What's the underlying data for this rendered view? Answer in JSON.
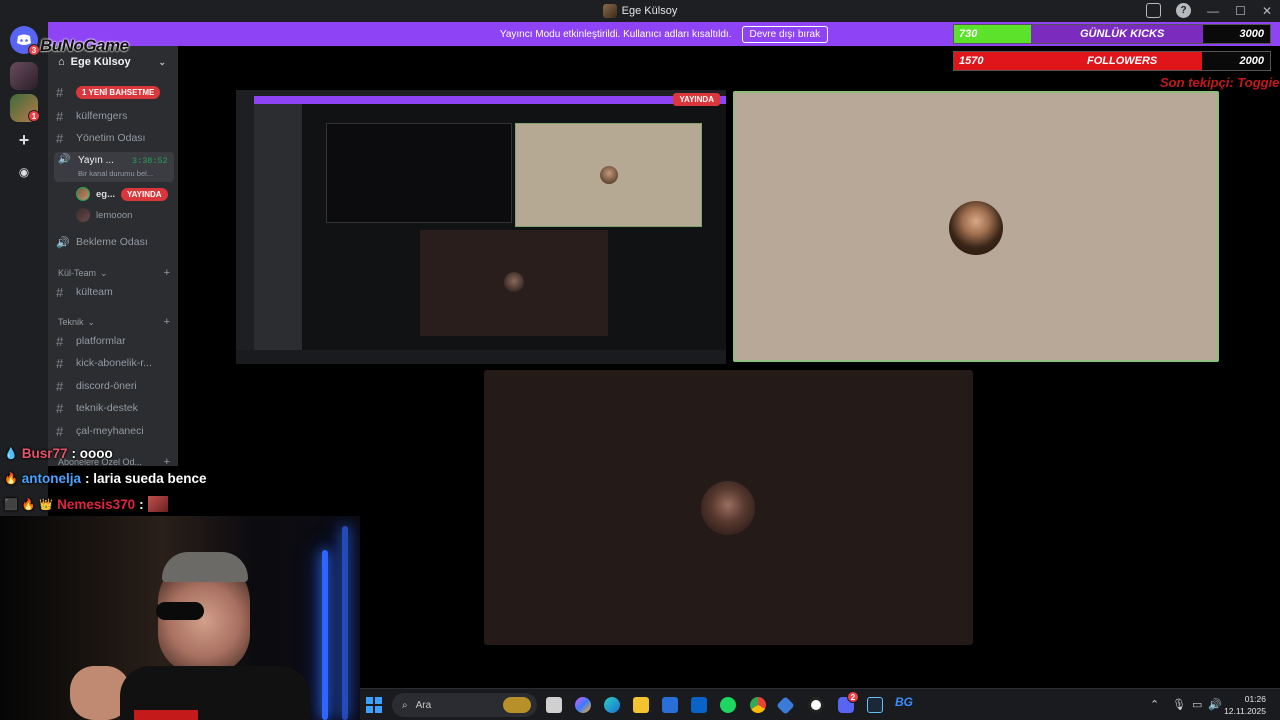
{
  "window": {
    "title": "Ege Külsoy",
    "minimize_glyph": "—",
    "maximize_glyph": "☐",
    "close_glyph": "✕",
    "help_glyph": "?"
  },
  "streamer_banner": {
    "message": "Yayıncı Modu etkinleştirildi. Kullanıcı adları kısaltıldı.",
    "disable_button": "Devre dışı bırak",
    "color": "#8e44f4"
  },
  "overlay": {
    "brand": "BuNoGame",
    "daily_kicks": {
      "current": "730",
      "label": "GÜNLÜK KICKS",
      "goal": "3000",
      "progress_fraction": 0.243,
      "color": "#5ce22a"
    },
    "followers": {
      "current": "1570",
      "label": "FOLLOWERS",
      "goal": "2000",
      "progress_fraction": 0.785,
      "color": "#e0141b"
    },
    "last_tip": "Son tekipçi: Toggiet"
  },
  "rail": {
    "home_icon": "discord-logo-icon",
    "home_badge": "3",
    "server2_badge": "1",
    "add_glyph": "+",
    "explore_glyph": "◉"
  },
  "sidebar": {
    "server_name": "Ege Külsoy",
    "server_chevron": "⌄",
    "new_posts": "1 YENİ BAHSETME",
    "channels": {
      "kulfemgers": "külfemgers",
      "yonetim": "Yönetim Odası",
      "yayin": "Yayın ...",
      "yayin_timer": "3:38:52",
      "yayin_status": "Bir kanal durumu bel...",
      "bekleme": "Bekleme Odası",
      "kulteam": "külteam",
      "platformlar": "platformlar",
      "kick_abonelik": "kick-abonelik-r...",
      "discord_oneri": "discord-öneri",
      "teknik_destek": "teknik-destek",
      "cal_meyhaneci": "çal-meyhaneci"
    },
    "categories": {
      "kul_team": "Kül-Team",
      "teknik": "Teknik",
      "aboneler": "Abonelere Özel Od..."
    },
    "voice_users": [
      {
        "name": "eg...",
        "badge": "YAYINDA"
      },
      {
        "name": "lemooon",
        "badge": ""
      }
    ],
    "hash_glyph": "#",
    "speaker_glyph": "🔊",
    "plus_glyph": "+"
  },
  "stage": {
    "screen_share_live_badge": "YAYINDA",
    "nested_title": "Ege Külsoy"
  },
  "chat": [
    {
      "user": "Busr77",
      "message": ": oooo",
      "user_color": "#e8546b"
    },
    {
      "user": "antonelja",
      "message": ": laria sueda bence",
      "user_color": "#4aa3ff"
    },
    {
      "user": "Nemesis370",
      "message": ":",
      "user_color": "#e0243c"
    }
  ],
  "taskbar": {
    "search_placeholder": "Ara",
    "clock_time": "01:26",
    "clock_date": "12.11.2025",
    "discord_badge": "2",
    "bg_label": "BG",
    "tray_up": "⌃"
  }
}
